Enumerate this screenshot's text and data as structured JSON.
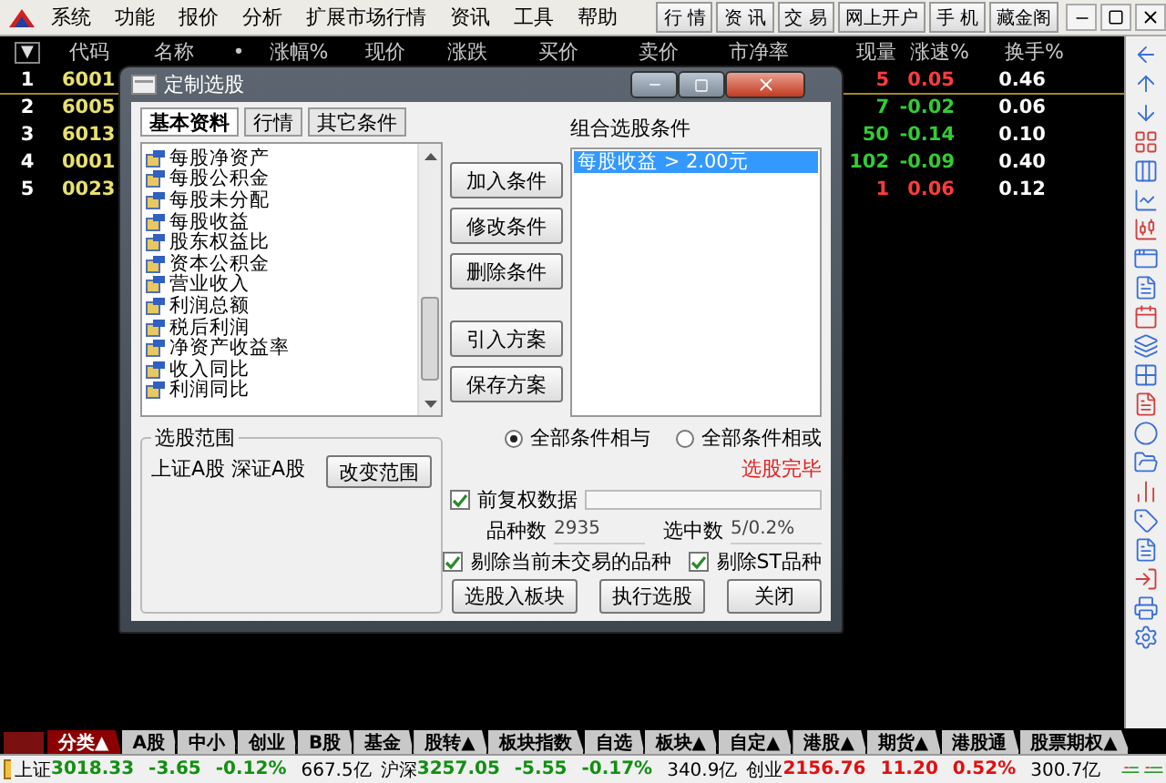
{
  "menubar": {
    "items": [
      "系统",
      "功能",
      "报价",
      "分析",
      "扩展市场行情",
      "资讯",
      "工具",
      "帮助"
    ],
    "quick_buttons": [
      "行 情",
      "资 讯",
      "交 易",
      "网上开户",
      "手 机",
      "藏金阁"
    ]
  },
  "quote_table": {
    "sort_marker": "▼",
    "columns": [
      "代码",
      "名称",
      "•",
      "涨幅%",
      "现价",
      "涨跌",
      "买价",
      "卖价",
      "市净率",
      "现量",
      "涨速%",
      "换手%"
    ],
    "rows": [
      {
        "index": "1",
        "code": "6001",
        "volume": "5",
        "speed": "0.05",
        "turnover": "0.46",
        "color": "#ff3c3c",
        "selected": true
      },
      {
        "index": "2",
        "code": "6005",
        "volume": "7",
        "speed": "-0.02",
        "turnover": "0.06",
        "color": "#33cc33",
        "selected": false
      },
      {
        "index": "3",
        "code": "6013",
        "volume": "50",
        "speed": "-0.14",
        "turnover": "0.10",
        "color": "#33cc33",
        "selected": false
      },
      {
        "index": "4",
        "code": "0001",
        "volume": "102",
        "speed": "-0.09",
        "turnover": "0.40",
        "color": "#33cc33",
        "selected": false
      },
      {
        "index": "5",
        "code": "0023",
        "volume": "1",
        "speed": "0.06",
        "turnover": "0.12",
        "color": "#ff3c3c",
        "selected": false
      }
    ]
  },
  "dialog": {
    "title": "定制选股",
    "tabs": [
      {
        "label": "基本资料",
        "selected": true
      },
      {
        "label": "行情",
        "selected": false
      },
      {
        "label": "其它条件",
        "selected": false
      }
    ],
    "fields": [
      "每股净资产",
      "每股公积金",
      "每股未分配",
      "每股收益",
      "股东权益比",
      "资本公积金",
      "营业收入",
      "利润总额",
      "税后利润",
      "净资产收益率",
      "收入同比",
      "利润同比"
    ],
    "action_buttons": [
      "加入条件",
      "修改条件",
      "删除条件"
    ],
    "plan_buttons": [
      "引入方案",
      "保存方案"
    ],
    "conditions_label": "组合选股条件",
    "conditions": [
      {
        "text": "每股收益 > 2.00元",
        "selected": true
      }
    ],
    "range": {
      "title": "选股范围",
      "text": "上证A股 深证A股",
      "button": "改变范围"
    },
    "logic": [
      {
        "label": "全部条件相与",
        "selected": true
      },
      {
        "label": "全部条件相或",
        "selected": false
      }
    ],
    "status": "选股完毕",
    "adjusted": {
      "label": "前复权数据",
      "checked": true
    },
    "count_label": "品种数",
    "count": "2935",
    "selected_label": "选中数",
    "selected_count": "5/0.2%",
    "filters": [
      {
        "label": "剔除当前未交易的品种",
        "checked": true
      },
      {
        "label": "剔除ST品种",
        "checked": true
      }
    ],
    "bottom_buttons": [
      "选股入板块",
      "执行选股",
      "关闭"
    ]
  },
  "market_tabs": [
    {
      "label": "分类▲",
      "selected": true
    },
    {
      "label": "A股",
      "selected": false
    },
    {
      "label": "中小",
      "selected": false
    },
    {
      "label": "创业",
      "selected": false
    },
    {
      "label": "B股",
      "selected": false
    },
    {
      "label": "基金",
      "selected": false
    },
    {
      "label": "股转▲",
      "selected": false
    },
    {
      "label": "板块指数",
      "selected": false
    },
    {
      "label": "自选",
      "selected": false
    },
    {
      "label": "板块▲",
      "selected": false
    },
    {
      "label": "自定▲",
      "selected": false
    },
    {
      "label": "港股▲",
      "selected": false
    },
    {
      "label": "期货▲",
      "selected": false
    },
    {
      "label": "港股通",
      "selected": false
    },
    {
      "label": "股票期权▲",
      "selected": false
    }
  ],
  "status_bar": {
    "indices": [
      {
        "name": "上证",
        "value": "3018.33",
        "change": "-3.65",
        "percent": "-0.12%",
        "amount": "667.5亿",
        "color": "#129012"
      },
      {
        "name": "沪深",
        "value": "3257.05",
        "change": "-5.55",
        "percent": "-0.17%",
        "amount": "340.9亿",
        "color": "#129012"
      },
      {
        "name": "创业",
        "value": "2156.76",
        "change": "11.20",
        "percent": "0.52%",
        "amount": "300.7亿",
        "color": "#e01010"
      }
    ]
  }
}
